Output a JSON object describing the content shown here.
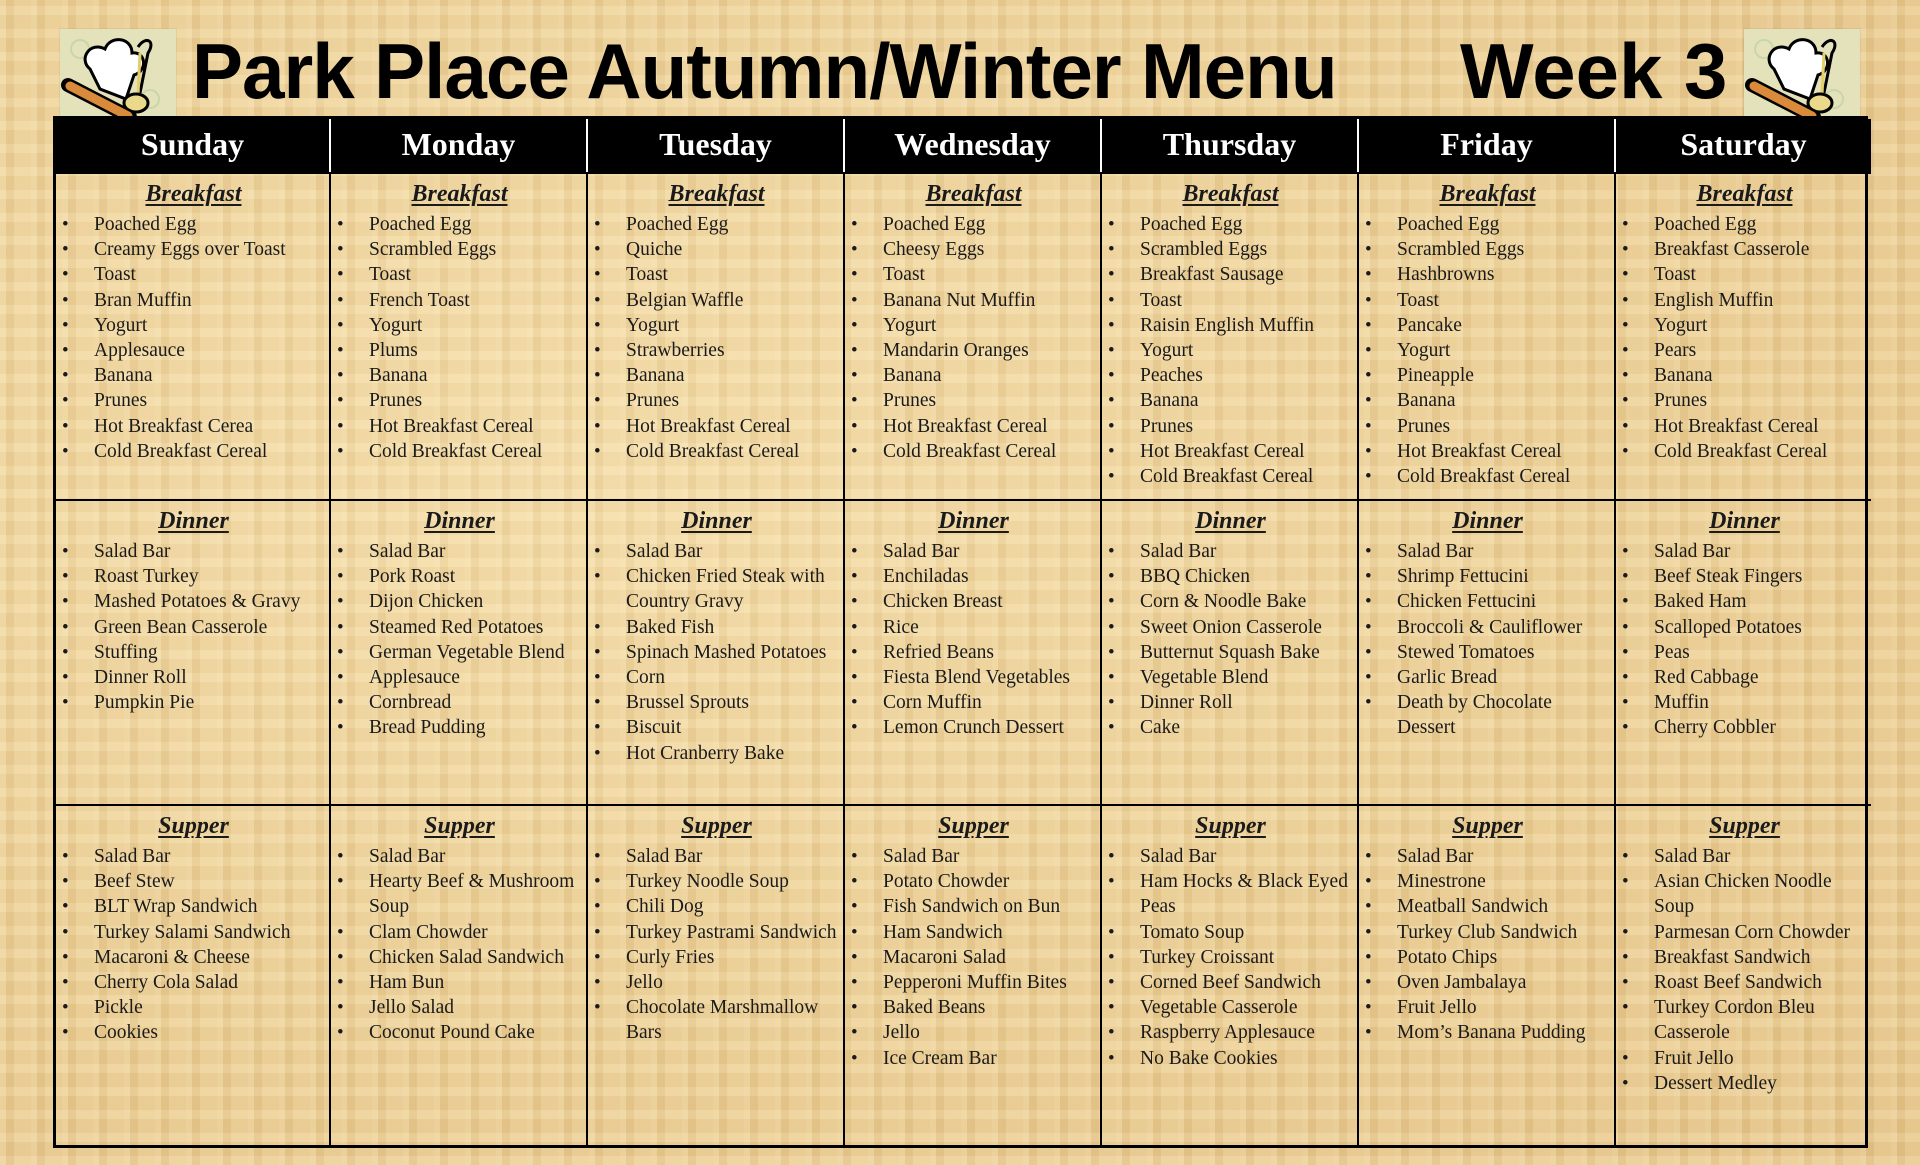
{
  "header": {
    "title": "Park Place Autumn/Winter Menu",
    "week": "Week 3",
    "logo_icon": "chef-hat-rolling-pin-ladle-icon"
  },
  "meal_labels": [
    "Breakfast",
    "Dinner",
    "Supper"
  ],
  "days": [
    {
      "name": "Sunday",
      "breakfast": [
        "Poached Egg",
        "Creamy Eggs over Toast",
        "Toast",
        "Bran Muffin",
        "Yogurt",
        "Applesauce",
        "Banana",
        "Prunes",
        "Hot Breakfast Cerea",
        "Cold Breakfast Cereal"
      ],
      "dinner": [
        "Salad Bar",
        "Roast Turkey",
        "Mashed Potatoes & Gravy",
        "Green Bean Casserole",
        "Stuffing",
        "Dinner Roll",
        "Pumpkin Pie"
      ],
      "supper": [
        "Salad Bar",
        "Beef Stew",
        "BLT Wrap Sandwich",
        "Turkey Salami Sandwich",
        "Macaroni & Cheese",
        "Cherry Cola Salad",
        "Pickle",
        "Cookies"
      ]
    },
    {
      "name": "Monday",
      "breakfast": [
        "Poached Egg",
        "Scrambled Eggs",
        "Toast",
        "French Toast",
        "Yogurt",
        "Plums",
        "Banana",
        "Prunes",
        "Hot Breakfast Cereal",
        "Cold Breakfast Cereal"
      ],
      "dinner": [
        "Salad Bar",
        "Pork Roast",
        "Dijon Chicken",
        "Steamed Red Potatoes",
        "German Vegetable Blend",
        "Applesauce",
        "Cornbread",
        "Bread Pudding"
      ],
      "supper": [
        "Salad Bar",
        "Hearty Beef & Mushroom Soup",
        "Clam Chowder",
        "Chicken Salad Sandwich",
        "Ham Bun",
        "Jello Salad",
        "Coconut Pound Cake"
      ]
    },
    {
      "name": "Tuesday",
      "breakfast": [
        "Poached Egg",
        "Quiche",
        "Toast",
        "Belgian Waffle",
        "Yogurt",
        "Strawberries",
        "Banana",
        "Prunes",
        "Hot Breakfast Cereal",
        "Cold Breakfast Cereal"
      ],
      "dinner": [
        "Salad Bar",
        "Chicken Fried Steak with Country Gravy",
        "Baked Fish",
        "Spinach Mashed Potatoes",
        "Corn",
        "Brussel Sprouts",
        "Biscuit",
        "Hot Cranberry Bake"
      ],
      "supper": [
        "Salad Bar",
        "Turkey Noodle Soup",
        "Chili Dog",
        "Turkey Pastrami Sandwich",
        "Curly Fries",
        "Jello",
        "Chocolate Marshmallow Bars"
      ]
    },
    {
      "name": "Wednesday",
      "breakfast": [
        "Poached Egg",
        "Cheesy Eggs",
        "Toast",
        "Banana Nut Muffin",
        "Yogurt",
        "Mandarin Oranges",
        "Banana",
        "Prunes",
        "Hot Breakfast Cereal",
        "Cold Breakfast Cereal"
      ],
      "dinner": [
        "Salad Bar",
        "Enchiladas",
        "Chicken Breast",
        "Rice",
        "Refried Beans",
        "Fiesta Blend Vegetables",
        "Corn Muffin",
        "Lemon Crunch Dessert"
      ],
      "supper": [
        "Salad Bar",
        "Potato Chowder",
        "Fish Sandwich on Bun",
        "Ham Sandwich",
        "Macaroni Salad",
        "Pepperoni Muffin Bites",
        "Baked Beans",
        "Jello",
        "Ice Cream Bar"
      ]
    },
    {
      "name": "Thursday",
      "breakfast": [
        "Poached Egg",
        "Scrambled Eggs",
        "Breakfast Sausage",
        "Toast",
        "Raisin English Muffin",
        "Yogurt",
        "Peaches",
        "Banana",
        "Prunes",
        "Hot Breakfast Cereal",
        "Cold Breakfast Cereal"
      ],
      "dinner": [
        "Salad Bar",
        "BBQ Chicken",
        "Corn & Noodle Bake",
        "Sweet Onion Casserole",
        "Butternut Squash Bake",
        "Vegetable Blend",
        "Dinner Roll",
        "Cake"
      ],
      "supper": [
        "Salad Bar",
        "Ham Hocks & Black Eyed Peas",
        "Tomato Soup",
        "Turkey Croissant",
        "Corned Beef Sandwich",
        "Vegetable Casserole",
        "Raspberry Applesauce",
        "No Bake Cookies"
      ]
    },
    {
      "name": "Friday",
      "breakfast": [
        "Poached Egg",
        "Scrambled Eggs",
        "Hashbrowns",
        "Toast",
        "Pancake",
        "Yogurt",
        "Pineapple",
        "Banana",
        "Prunes",
        "Hot Breakfast Cereal",
        "Cold Breakfast Cereal"
      ],
      "dinner": [
        "Salad Bar",
        "Shrimp Fettucini",
        "Chicken Fettucini",
        "Broccoli & Cauliflower",
        "Stewed Tomatoes",
        "Garlic Bread",
        "Death by Chocolate Dessert"
      ],
      "supper": [
        "Salad Bar",
        "Minestrone",
        "Meatball Sandwich",
        "Turkey Club Sandwich",
        "Potato Chips",
        "Oven Jambalaya",
        "Fruit Jello",
        "Mom’s Banana Pudding"
      ]
    },
    {
      "name": "Saturday",
      "breakfast": [
        "Poached Egg",
        "Breakfast Casserole",
        "Toast",
        "English Muffin",
        "Yogurt",
        "Pears",
        "Banana",
        "Prunes",
        "Hot Breakfast Cereal",
        "Cold Breakfast Cereal"
      ],
      "dinner": [
        "Salad Bar",
        "Beef Steak Fingers",
        "Baked Ham",
        "Scalloped Potatoes",
        "Peas",
        "Red Cabbage",
        "Muffin",
        "Cherry Cobbler"
      ],
      "supper": [
        "Salad Bar",
        "Asian Chicken Noodle Soup",
        "Parmesan Corn Chowder",
        "Breakfast Sandwich",
        "Roast Beef Sandwich",
        "Turkey Cordon Bleu Casserole",
        "Fruit Jello",
        "Dessert Medley"
      ]
    }
  ]
}
